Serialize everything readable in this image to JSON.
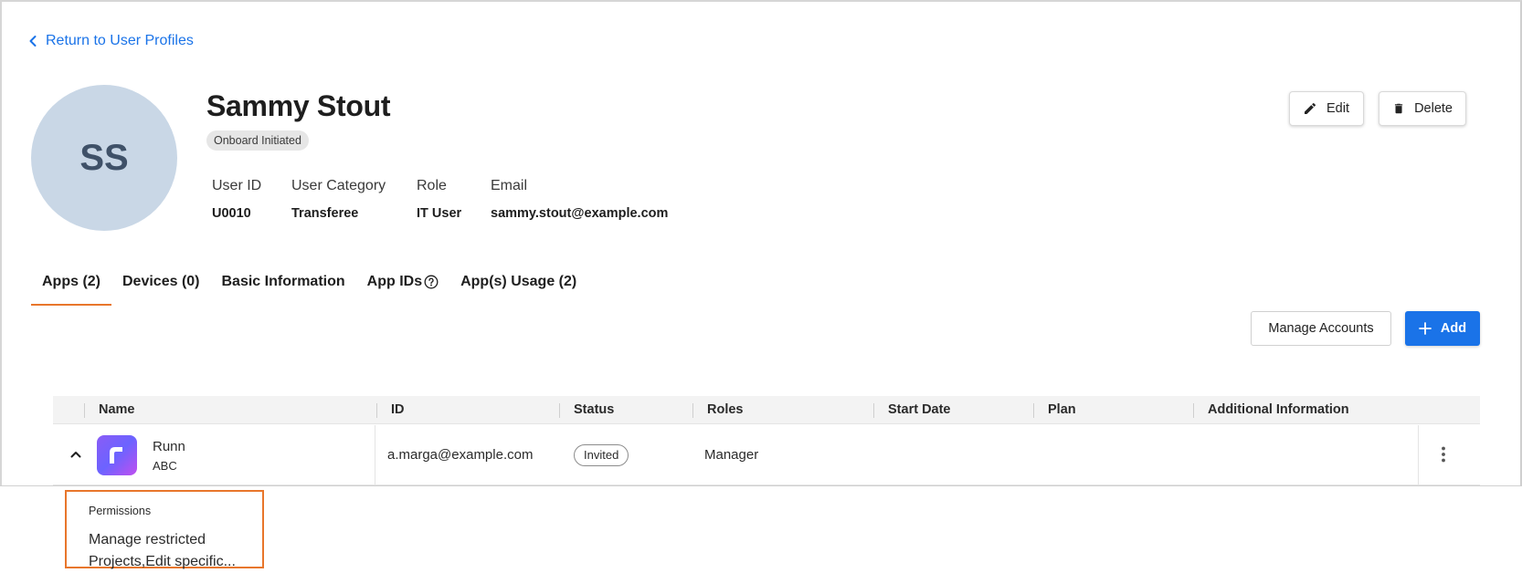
{
  "back_link": {
    "label": "Return to User Profiles"
  },
  "profile": {
    "initials": "SS",
    "name": "Sammy Stout",
    "status": "Onboard Initiated",
    "fields": [
      {
        "label": "User ID",
        "value": "U0010"
      },
      {
        "label": "User Category",
        "value": "Transferee"
      },
      {
        "label": "Role",
        "value": "IT User"
      },
      {
        "label": "Email",
        "value": "sammy.stout@example.com"
      }
    ]
  },
  "actions": {
    "edit_label": "Edit",
    "delete_label": "Delete"
  },
  "tabs": [
    {
      "label": "Apps (2)",
      "active": true
    },
    {
      "label": "Devices (0)"
    },
    {
      "label": "Basic Information"
    },
    {
      "label": "App IDs"
    },
    {
      "label": "App(s) Usage (2)"
    }
  ],
  "toolbar": {
    "manage_label": "Manage Accounts",
    "add_label": "Add"
  },
  "table": {
    "columns": [
      "Name",
      "ID",
      "Status",
      "Roles",
      "Start Date",
      "Plan",
      "Additional Information"
    ],
    "rows": [
      {
        "app_name": "Runn",
        "app_sub": "ABC",
        "id": "a.marga@example.com",
        "status": "Invited",
        "roles": "Manager",
        "start_date": "",
        "plan": "",
        "additional": ""
      }
    ]
  },
  "expanded": {
    "permissions_label": "Permissions",
    "permissions_value": "Manage restricted Projects,Edit specific..."
  },
  "colors": {
    "accent": "#1a73e8",
    "tab_indicator": "#e8762b",
    "avatar_bg": "#c9d7e6"
  }
}
